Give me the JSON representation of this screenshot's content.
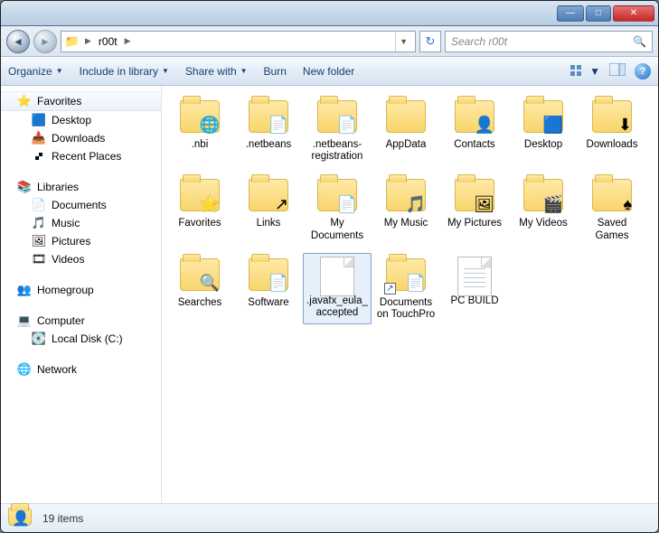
{
  "window": {
    "controls": {
      "min": "—",
      "max": "□",
      "close": "✕"
    }
  },
  "address": {
    "location": "r00t",
    "refresh_glyph": "↻"
  },
  "search": {
    "placeholder": "Search r00t",
    "icon_glyph": "🔍"
  },
  "toolbar": {
    "organize": "Organize",
    "include": "Include in library",
    "share": "Share with",
    "burn": "Burn",
    "newfolder": "New folder"
  },
  "sidebar": {
    "favorites": {
      "label": "Favorites",
      "items": [
        {
          "label": "Desktop",
          "icon": "🟦"
        },
        {
          "label": "Downloads",
          "icon": "📥"
        },
        {
          "label": "Recent Places",
          "icon": "🙾"
        }
      ]
    },
    "libraries": {
      "label": "Libraries",
      "items": [
        {
          "label": "Documents",
          "icon": "📄"
        },
        {
          "label": "Music",
          "icon": "🎵"
        },
        {
          "label": "Pictures",
          "icon": "🖼"
        },
        {
          "label": "Videos",
          "icon": "🎞"
        }
      ]
    },
    "homegroup": {
      "label": "Homegroup"
    },
    "computer": {
      "label": "Computer",
      "items": [
        {
          "label": "Local Disk (C:)",
          "icon": "💽"
        }
      ]
    },
    "network": {
      "label": "Network"
    }
  },
  "items": [
    {
      "name": ".nbi",
      "type": "folder",
      "overlay": "🌐"
    },
    {
      "name": ".netbeans",
      "type": "folder",
      "overlay": "📄"
    },
    {
      "name": ".netbeans-registration",
      "type": "folder",
      "overlay": "📄"
    },
    {
      "name": "AppData",
      "type": "folder"
    },
    {
      "name": "Contacts",
      "type": "folder",
      "overlay": "👤"
    },
    {
      "name": "Desktop",
      "type": "folder",
      "overlay": "🟦"
    },
    {
      "name": "Downloads",
      "type": "folder",
      "overlay": "⬇"
    },
    {
      "name": "Favorites",
      "type": "folder",
      "overlay": "⭐"
    },
    {
      "name": "Links",
      "type": "folder",
      "overlay": "↗"
    },
    {
      "name": "My Documents",
      "type": "folder",
      "overlay": "📄"
    },
    {
      "name": "My Music",
      "type": "folder",
      "overlay": "🎵"
    },
    {
      "name": "My Pictures",
      "type": "folder",
      "overlay": "🖼"
    },
    {
      "name": "My Videos",
      "type": "folder",
      "overlay": "🎬"
    },
    {
      "name": "Saved Games",
      "type": "folder",
      "overlay": "♠"
    },
    {
      "name": "Searches",
      "type": "folder",
      "overlay": "🔍"
    },
    {
      "name": "Software",
      "type": "folder",
      "overlay": "📄"
    },
    {
      "name": ".javafx_eula_accepted",
      "type": "file",
      "selected": true
    },
    {
      "name": "Documents on TouchPro",
      "type": "folder",
      "overlay": "📄",
      "shortcut": true
    },
    {
      "name": "PC BUILD",
      "type": "textfile"
    }
  ],
  "status": {
    "count_text": "19 items"
  }
}
